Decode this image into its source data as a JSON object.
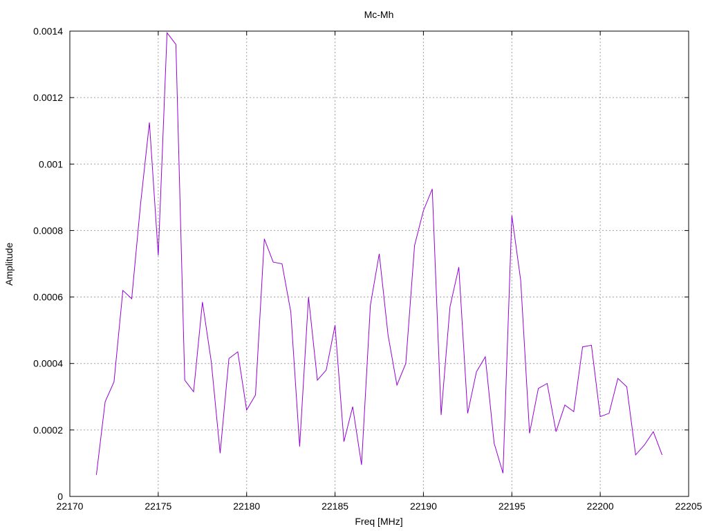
{
  "chart_data": {
    "type": "line",
    "title": "Mc-Mh",
    "xlabel": "Freq [MHz]",
    "ylabel": "Amplitude",
    "xlim": [
      22170,
      22205
    ],
    "ylim": [
      0,
      0.0014
    ],
    "x_ticks": [
      "22170",
      "22175",
      "22180",
      "22185",
      "22190",
      "22195",
      "22200",
      "22205"
    ],
    "y_ticks": [
      "0",
      "0.0002",
      "0.0004",
      "0.0006",
      "0.0008",
      "0.001",
      "0.0012",
      "0.0014"
    ],
    "grid": true,
    "series_color": "#9400d3",
    "series": [
      {
        "x": [
          22171.5,
          22172.0,
          22172.5,
          22173.0,
          22173.5,
          22174.0,
          22174.5,
          22175.0,
          22175.5,
          22176.0,
          22176.5,
          22177.0,
          22177.5,
          22178.0,
          22178.5,
          22179.0,
          22179.5,
          22180.0,
          22180.5,
          22181.0,
          22181.5,
          22182.0,
          22182.5,
          22183.0,
          22183.5,
          22184.0,
          22184.5,
          22185.0,
          22185.5,
          22186.0,
          22186.5,
          22187.0,
          22187.5,
          22188.0,
          22188.5,
          22189.0,
          22189.5,
          22190.0,
          22190.5,
          22191.0,
          22191.5,
          22192.0,
          22192.5,
          22193.0,
          22193.5,
          22194.0,
          22194.5,
          22195.0,
          22195.5,
          22196.0,
          22196.5,
          22197.0,
          22197.5,
          22198.0,
          22198.5,
          22199.0,
          22199.5,
          22200.0,
          22200.5,
          22201.0,
          22201.5,
          22202.0,
          22202.5,
          22203.0,
          22203.5
        ],
        "y": [
          6.5e-05,
          0.000285,
          0.000345,
          0.00062,
          0.000595,
          0.00088,
          0.001125,
          0.000725,
          0.001395,
          0.00136,
          0.00035,
          0.000315,
          0.000585,
          0.000405,
          0.00013,
          0.000415,
          0.000435,
          0.00026,
          0.000305,
          0.000775,
          0.000705,
          0.0007,
          0.000555,
          0.00015,
          0.0006,
          0.00035,
          0.00038,
          0.000515,
          0.000165,
          0.00027,
          9.5e-05,
          0.000575,
          0.00073,
          0.000485,
          0.000335,
          0.0004,
          0.000755,
          0.00086,
          0.000925,
          0.000245,
          0.00057,
          0.00069,
          0.00025,
          0.000375,
          0.00042,
          0.00016,
          7e-05,
          0.000845,
          0.00065,
          0.00019,
          0.000325,
          0.00034,
          0.000195,
          0.000275,
          0.000255,
          0.00045,
          0.000455,
          0.00024,
          0.00025,
          0.000355,
          0.00033,
          0.000125,
          0.000155,
          0.000195,
          0.000125
        ]
      }
    ]
  }
}
